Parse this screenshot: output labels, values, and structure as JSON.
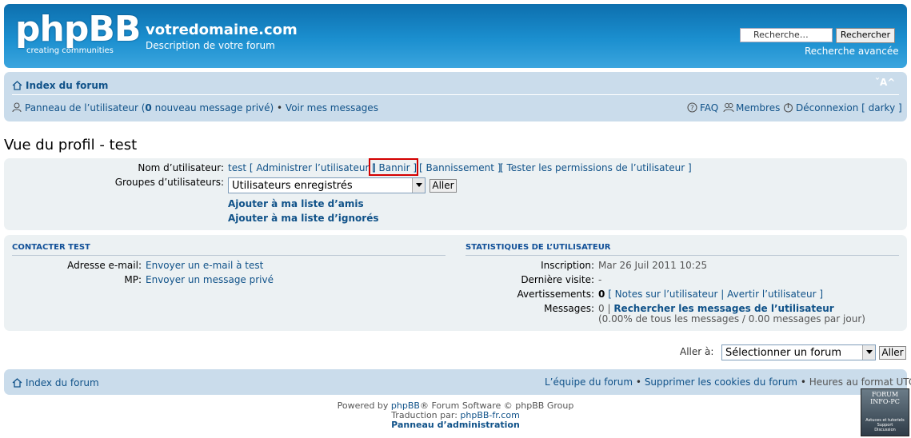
{
  "header": {
    "logo_text": "phpBB",
    "logo_tagline": "creating  communities",
    "site_title": "votredomaine.com",
    "site_description": "Description de votre forum",
    "search_placeholder": "Recherche…",
    "search_button": "Rechercher",
    "advanced_search": "Recherche avancée"
  },
  "navbar": {
    "index_label": "Index du forum",
    "font_size_control": "ˇA^",
    "ucp_prefix": "Panneau de l’utilisateur (",
    "ucp_count": "0",
    "ucp_suffix": " nouveau message privé)",
    "separator": " • ",
    "view_messages": "Voir mes messages",
    "faq": "FAQ",
    "members": "Membres",
    "logout": "Déconnexion [ darky ]"
  },
  "page_title": "Vue du profil - test",
  "profile": {
    "username_label": "Nom d’utilisateur:",
    "username": "test",
    "admin_user": "[ Administrer l’utilisateur ]",
    "ban": "[ Bannir ]",
    "banishment": "[ Bannissement ]",
    "test_permissions": "[ Tester les permissions de l’utilisateur ]",
    "groups_label": "Groupes d’utilisateurs:",
    "groups_selected": "Utilisateurs enregistrés",
    "go_button": "Aller",
    "add_friends": "Ajouter à ma liste d’amis",
    "add_ignored": "Ajouter à ma liste d’ignorés"
  },
  "contact": {
    "title": "CONTACTER TEST",
    "email_label": "Adresse e-mail:",
    "email_value": "Envoyer un e-mail à test",
    "pm_label": "MP:",
    "pm_value": "Envoyer un message privé"
  },
  "stats": {
    "title": "STATISTIQUES DE L’UTILISATEUR",
    "joined_label": "Inscription:",
    "joined_value": "Mar 26 Juil 2011 10:25",
    "last_visit_label": "Dernière visite:",
    "last_visit_value": "-",
    "warnings_label": "Avertissements:",
    "warnings_count": "0",
    "warnings_links": "[ Notes sur l’utilisateur | Avertir l’utilisateur ]",
    "posts_label": "Messages:",
    "posts_count": "0",
    "posts_sep": " | ",
    "search_posts": "Rechercher les messages de l’utilisateur",
    "posts_ratio": "(0.00% de tous les messages / 0.00 messages par jour)"
  },
  "jumpbox": {
    "label": "Aller à:",
    "selected": "Sélectionner un forum",
    "button": "Aller"
  },
  "footer_nav": {
    "index_label": "Index du forum",
    "team": "L’équipe du forum",
    "sep": " • ",
    "delete_cookies": "Supprimer les cookies du forum",
    "timezone": "Heures au format UTC"
  },
  "credits": {
    "powered_prefix": "Powered by ",
    "phpbb": "phpBB",
    "powered_suffix": "® Forum Software © phpBB Group",
    "translation_prefix": "Traduction par: ",
    "translation_link": "phpBB-fr.com",
    "admin_panel": "Panneau d’administration"
  },
  "badge": {
    "line1": "FORUM",
    "line2": "INFO-PC",
    "line3": "Astuces et tutoriels",
    "line4": "Support",
    "line5": "Discussion"
  },
  "colors": {
    "header_blue": "#1b8fcf",
    "link": "#105289",
    "navbar_bg": "#cadceb",
    "panel_bg": "#ecf1f3",
    "highlight": "#d40000"
  }
}
